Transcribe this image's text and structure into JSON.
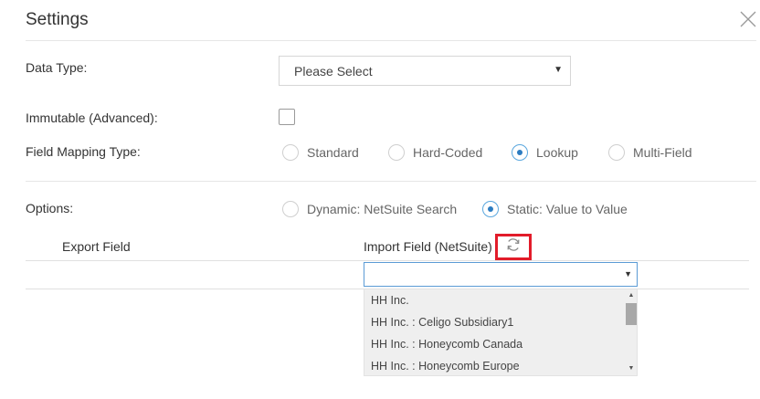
{
  "dialog": {
    "title": "Settings",
    "close_icon": "close-icon"
  },
  "fields": {
    "data_type_label": "Data Type:",
    "data_type_value": "Please Select",
    "immutable_label": "Immutable (Advanced):",
    "immutable_checked": false,
    "mapping_type_label": "Field Mapping Type:",
    "mapping_types": [
      {
        "label": "Standard",
        "checked": false
      },
      {
        "label": "Hard-Coded",
        "checked": false
      },
      {
        "label": "Lookup",
        "checked": true
      },
      {
        "label": "Multi-Field",
        "checked": false
      }
    ],
    "options_label": "Options:",
    "options": [
      {
        "label": "Dynamic: NetSuite Search",
        "checked": false
      },
      {
        "label": "Static: Value to Value",
        "checked": true
      }
    ]
  },
  "mapping_table": {
    "export_header": "Export Field",
    "import_header": "Import Field (NetSuite)",
    "refresh_icon": "refresh-icon",
    "import_input_value": "",
    "dropdown_options": [
      "HH Inc.",
      "HH Inc. : Celigo Subsidiary1",
      "HH Inc. : Honeycomb Canada",
      "HH Inc. : Honeycomb Europe"
    ]
  },
  "colors": {
    "accent": "#2c7cc1",
    "highlight_border": "#e21c2a",
    "input_focus": "#5b9bd5"
  }
}
